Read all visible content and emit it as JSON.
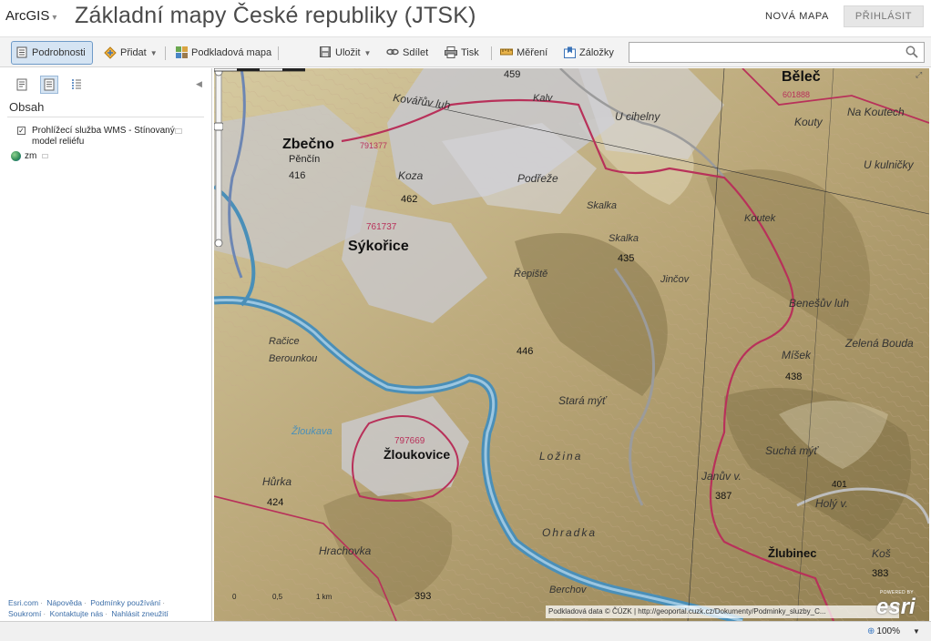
{
  "header": {
    "brand": "ArcGIS",
    "title": "Základní mapy České republiky (JTSK)",
    "new_map": "NOVÁ MAPA",
    "sign_in": "PŘIHLÁSIT"
  },
  "toolbar": {
    "details": "Podrobnosti",
    "add": "Přidat",
    "basemap": "Podkladová mapa",
    "save": "Uložit",
    "share": "Sdílet",
    "print": "Tisk",
    "measure": "Měření",
    "bookmarks": "Záložky",
    "search_placeholder": ""
  },
  "sidebar": {
    "heading": "Obsah",
    "layer": {
      "label": "Prohlížecí služba WMS - Stínovaný model reliéfu",
      "checked": true
    },
    "sublayer": "zm",
    "footer": [
      "Esri.com",
      "Nápověda",
      "Podmínky používání",
      "Soukromí",
      "Kontaktujte nás",
      "Nahlásit zneužití"
    ]
  },
  "map": {
    "labels": [
      {
        "text": "459",
        "kind": "elev"
      },
      {
        "text": "Kalv",
        "kind": "place"
      },
      {
        "text": "Kovářův luh",
        "kind": "place"
      },
      {
        "text": "Běleč",
        "kind": "village"
      },
      {
        "text": "601888",
        "kind": "code"
      },
      {
        "text": "Kouty",
        "kind": "place"
      },
      {
        "text": "Na Koutech",
        "kind": "place"
      },
      {
        "text": "U cihelny",
        "kind": "place"
      },
      {
        "text": "Zbečno",
        "kind": "village"
      },
      {
        "text": "791377",
        "kind": "code"
      },
      {
        "text": "Pěnčín",
        "kind": "place"
      },
      {
        "text": "416",
        "kind": "elev"
      },
      {
        "text": "Koza",
        "kind": "place"
      },
      {
        "text": "462",
        "kind": "elev"
      },
      {
        "text": "Podřeže",
        "kind": "place"
      },
      {
        "text": "U kulničky",
        "kind": "place"
      },
      {
        "text": "Skalka",
        "kind": "place"
      },
      {
        "text": "Koutek",
        "kind": "place"
      },
      {
        "text": "761737",
        "kind": "code"
      },
      {
        "text": "Sýkořice",
        "kind": "village"
      },
      {
        "text": "Skalka",
        "kind": "place"
      },
      {
        "text": "435",
        "kind": "elev"
      },
      {
        "text": "Řepiště",
        "kind": "place"
      },
      {
        "text": "Jinčov",
        "kind": "place"
      },
      {
        "text": "Benešův luh",
        "kind": "place"
      },
      {
        "text": "Račice",
        "kind": "place"
      },
      {
        "text": "Berounkou",
        "kind": "place"
      },
      {
        "text": "446",
        "kind": "elev"
      },
      {
        "text": "Míšek",
        "kind": "place"
      },
      {
        "text": "438",
        "kind": "elev"
      },
      {
        "text": "Zelená Bouda",
        "kind": "place"
      },
      {
        "text": "Stará mýť",
        "kind": "place"
      },
      {
        "text": "Žloukava",
        "kind": "place"
      },
      {
        "text": "797669",
        "kind": "code"
      },
      {
        "text": "Žloukovice",
        "kind": "village"
      },
      {
        "text": "Ložina",
        "kind": "place"
      },
      {
        "text": "Suchá mýť",
        "kind": "place"
      },
      {
        "text": "Hůrka",
        "kind": "place"
      },
      {
        "text": "424",
        "kind": "elev"
      },
      {
        "text": "Janův v.",
        "kind": "place"
      },
      {
        "text": "387",
        "kind": "elev"
      },
      {
        "text": "401",
        "kind": "elev"
      },
      {
        "text": "Holý v.",
        "kind": "place"
      },
      {
        "text": "Ohradka",
        "kind": "place"
      },
      {
        "text": "Hrachovka",
        "kind": "place"
      },
      {
        "text": "Žlubinec",
        "kind": "village"
      },
      {
        "text": "Koš",
        "kind": "place"
      },
      {
        "text": "383",
        "kind": "elev"
      },
      {
        "text": "393",
        "kind": "elev"
      },
      {
        "text": "Berchov",
        "kind": "place"
      }
    ],
    "scale_labels": [
      "0",
      "0,5",
      "1 km"
    ],
    "attribution": "Podkladová data © ČÚZK | http://geoportal.cuzk.cz/Dokumenty/Podminky_sluzby_C...",
    "esri_powered": "POWERED BY",
    "esri": "esri"
  },
  "status": {
    "zoom": "100%"
  },
  "colors": {
    "accent": "#6f9bc8",
    "boundary": "#b8315a",
    "river": "#4a8fb8",
    "terrain": "#bba97b",
    "built": "#c8c8cc"
  }
}
